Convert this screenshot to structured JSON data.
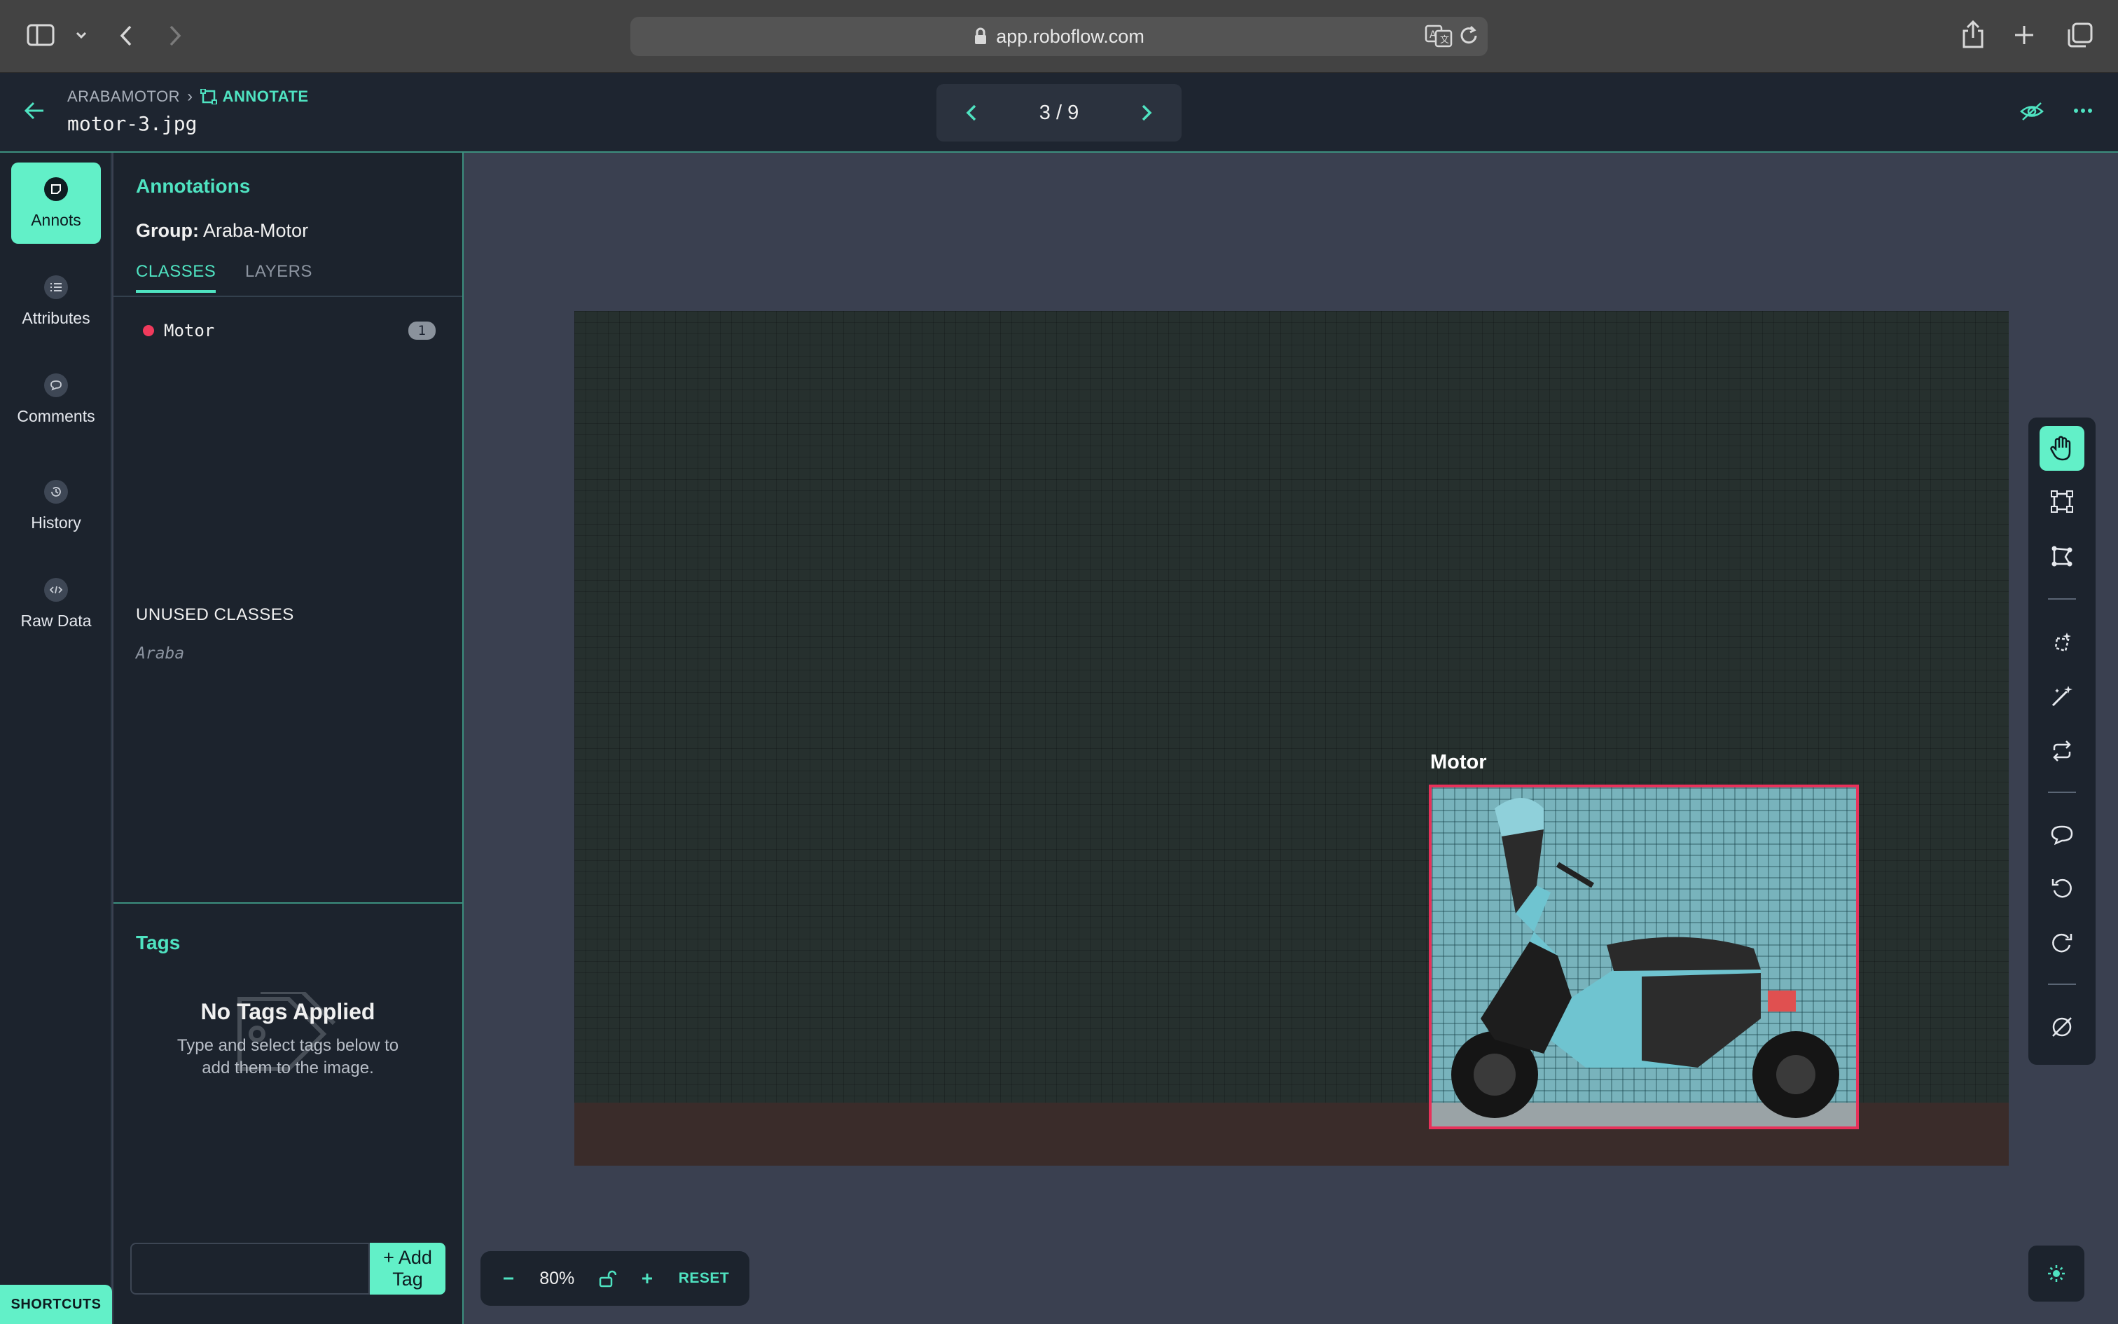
{
  "browser": {
    "url": "app.roboflow.com"
  },
  "header": {
    "project": "ARABAMOTOR",
    "mode": "ANNOTATE",
    "file_name": "motor-3.jpg",
    "pager": "3 / 9"
  },
  "rail": {
    "items": [
      {
        "label": "Annots"
      },
      {
        "label": "Attributes"
      },
      {
        "label": "Comments"
      },
      {
        "label": "History"
      },
      {
        "label": "Raw Data"
      }
    ],
    "shortcuts": "SHORTCUTS"
  },
  "annotations": {
    "title": "Annotations",
    "group_label": "Group:",
    "group_name": "Araba-Motor",
    "tabs": [
      "CLASSES",
      "LAYERS"
    ],
    "classes": [
      {
        "name": "Motor",
        "count": "1",
        "color": "#f03a5c"
      }
    ],
    "unused_title": "UNUSED CLASSES",
    "unused_classes": [
      "Araba"
    ]
  },
  "tags": {
    "title": "Tags",
    "empty_title": "No Tags Applied",
    "empty_line1": "Type and select tags below to",
    "empty_line2": "add them to the image.",
    "input_value": "",
    "add_button": "+ Add Tag"
  },
  "canvas": {
    "box_label": "Motor",
    "box_color": "#e8315a"
  },
  "zoom": {
    "value": "80%",
    "reset": "RESET"
  },
  "colors": {
    "accent": "#4fe3c1",
    "accent_fill": "#62f0c8",
    "panel": "#1c232d",
    "canvas_bg": "#3a4050"
  }
}
